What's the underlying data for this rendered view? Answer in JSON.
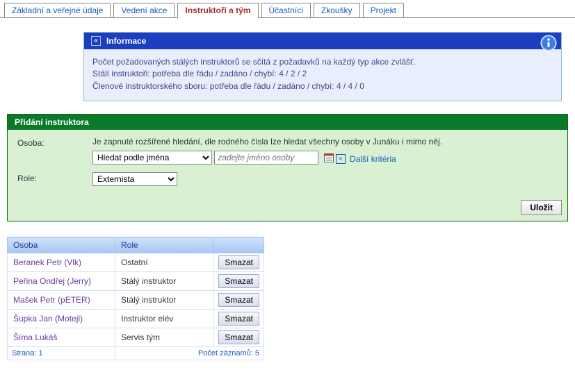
{
  "tabs": [
    {
      "label": "Základní a veřejné údaje",
      "active": false
    },
    {
      "label": "Vedení akce",
      "active": false
    },
    {
      "label": "Instruktoři a tým",
      "active": true
    },
    {
      "label": "Účastníci",
      "active": false
    },
    {
      "label": "Zkoušky",
      "active": false
    },
    {
      "label": "Projekt",
      "active": false
    }
  ],
  "info": {
    "title": "Informace",
    "line1": "Počet požadovaných stálých instruktorů se sčítá z požadavků na každý typ akce zvlášť.",
    "line2": "Stálí instruktoři: potřeba dle řádu / zadáno / chybí: 4 / 2 / 2",
    "line3": "Členové instruktorského sboru: potřeba dle řádu / zadáno / chybí: 4 / 4 / 0"
  },
  "add": {
    "title": "Přidání instruktora",
    "person_label": "Osoba:",
    "hint": "Je zapnuté rozšířené hledání, dle rodného čísla lze hledat všechny osoby v Junáku i mimo něj.",
    "search_mode": "Hledat podle jména",
    "search_placeholder": "zadejte jméno osoby",
    "more_criteria": "Další kritéria",
    "role_label": "Role:",
    "role_value": "Externista",
    "save": "Uložit"
  },
  "table": {
    "col_person": "Osoba",
    "col_role": "Role",
    "delete": "Smazat",
    "rows": [
      {
        "person": "Beranek Petr (Vlk)",
        "role": "Ostatní"
      },
      {
        "person": "Peřina Ondřej (Jerry)",
        "role": "Stálý instruktor"
      },
      {
        "person": "Mašek Petr (pETER)",
        "role": "Stálý instruktor"
      },
      {
        "person": "Šupka Jan (Motejl)",
        "role": "Instruktor elév"
      },
      {
        "person": "Šíma Lukáš",
        "role": "Servis tým"
      }
    ],
    "page": "Strana: 1",
    "count": "Počet záznamů: 5"
  }
}
